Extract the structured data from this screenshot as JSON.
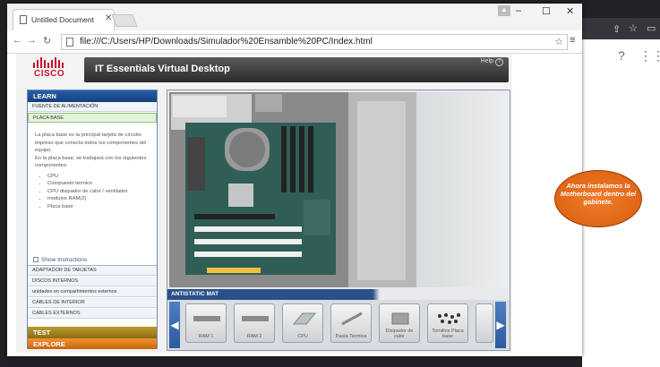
{
  "browser": {
    "tab_title": "Untitled Document",
    "url": "file:///C:/Users/HP/Downloads/Simulador%20Ensamble%20PC/Index.html",
    "window_controls": {
      "minimize": "–",
      "maximize": "☐",
      "close": "✕"
    }
  },
  "simulator": {
    "logo_text": "CISCO",
    "title": "IT Essentials Virtual Desktop",
    "help": "Help",
    "learn": {
      "header": "LEARN",
      "items_top": [
        "FUENTE DE ALIMENTACIÓN",
        "PLACA BASE"
      ],
      "active_item": "PLACA BASE",
      "description_lines": [
        "La placa base es la principal tarjeta de circuito impreso que conecta todos los componentes del equipo.",
        "En la placa base, se trabajará con los siguientes componentes:"
      ],
      "components": [
        "CPU",
        "Compuesto termico",
        "CPU disipador de calor / ventilador",
        "modulos RAM(2)",
        "Placa base"
      ],
      "show_instructions": "Show Instructions",
      "items_bottom": [
        "ADAPTADOR DE TARJETAS",
        "DISCOS INTERNOS",
        "unidades en compartimientos externos",
        "CABLES DE INTERIOR",
        "CABLES EXTERNOS"
      ]
    },
    "test_label": "TEST",
    "explore_label": "EXPLORE",
    "mat_label": "ANTISTATIC MAT",
    "tray_items": [
      {
        "label": "RAM 1"
      },
      {
        "label": "RAM 2"
      },
      {
        "label": "CPU"
      },
      {
        "label": "Pasta Termica"
      },
      {
        "label": "Disipador de calor"
      },
      {
        "label": "Tornillos Placa base"
      }
    ]
  },
  "callout_text": "Ahora instalamos la Motherboard dentro del gabinete."
}
